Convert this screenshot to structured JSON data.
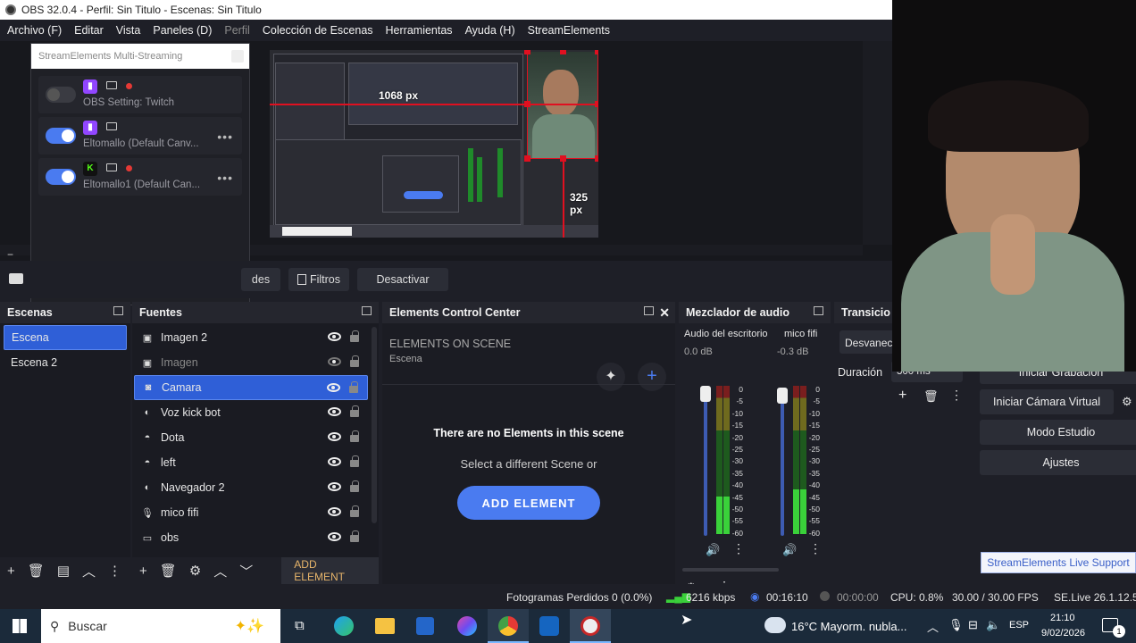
{
  "titlebar": {
    "title": "OBS 32.0.4 - Perfil: Sin Titulo - Escenas: Sin Titulo"
  },
  "menu": [
    "Archivo (F)",
    "Editar",
    "Vista",
    "Paneles (D)",
    "Perfil",
    "Colección de Escenas",
    "Herramientas",
    "Ayuda (H)",
    "StreamElements"
  ],
  "preview": {
    "width_label": "1068 px",
    "height_label": "325 px"
  },
  "multistream": {
    "title": "StreamElements Multi-Streaming",
    "rows": [
      {
        "label": "OBS Setting: Twitch",
        "platform": "twitch",
        "enabled": false
      },
      {
        "label": "Eltomallo (Default Canv...",
        "platform": "twitch",
        "enabled": true
      },
      {
        "label": "Eltomallo1 (Default Can...",
        "platform": "kick",
        "enabled": true
      }
    ]
  },
  "controls": {
    "props_partial": "des",
    "filters": "Filtros",
    "deactivate": "Desactivar"
  },
  "scenes": {
    "title": "Escenas",
    "items": [
      "Escena",
      "Escena 2"
    ]
  },
  "sources": {
    "title": "Fuentes",
    "items": [
      {
        "label": "Imagen 2",
        "icon": "image-icon",
        "visible": true
      },
      {
        "label": "Imagen",
        "icon": "image-icon",
        "visible": false
      },
      {
        "label": "Camara",
        "icon": "camera-icon",
        "visible": true
      },
      {
        "label": "Voz kick bot",
        "icon": "browser-icon",
        "visible": true
      },
      {
        "label": "Dota",
        "icon": "gamepad-icon",
        "visible": true
      },
      {
        "label": "left",
        "icon": "gamepad-icon",
        "visible": true
      },
      {
        "label": "Navegador 2",
        "icon": "browser-icon",
        "visible": true
      },
      {
        "label": "mico fifi",
        "icon": "microphone-icon",
        "visible": true
      },
      {
        "label": "obs",
        "icon": "monitor-icon",
        "visible": true
      }
    ],
    "add_element": "ADD ELEMENT"
  },
  "elements": {
    "title": "Elements Control Center",
    "heading": "ELEMENTS ON SCENE",
    "scene": "Escena",
    "empty": "There are no Elements in this scene",
    "hint": "Select a different Scene or",
    "button": "ADD ELEMENT"
  },
  "mixer": {
    "title": "Mezclador de audio",
    "channels": [
      {
        "name": "Audio del escritorio",
        "db": "0.0 dB",
        "level": 0.25
      },
      {
        "name": "mico fifi",
        "db": "-0.3 dB",
        "level": 0.3
      }
    ],
    "scale": [
      "0",
      "-5",
      "-10",
      "-15",
      "-20",
      "-25",
      "-30",
      "-35",
      "-40",
      "-45",
      "-50",
      "-55",
      "-60"
    ]
  },
  "transitions": {
    "title": "Transicio",
    "type": "Desvanec",
    "duration_label": "Duración",
    "duration": "300 ms"
  },
  "controls_right": [
    "Iniciar Grabación",
    "Iniciar Cámara Virtual",
    "Modo Estudio",
    "Ajustes"
  ],
  "se_support": "StreamElements Live Support",
  "status": {
    "dropped": "Fotogramas Perdidos 0 (0.0%)",
    "bitrate": "6216 kbps",
    "live_time": "00:16:10",
    "rec_time": "00:00:00",
    "cpu": "CPU: 0.8%",
    "fps": "30.00 / 30.00 FPS",
    "version": "SE.Live 26.1.12.53"
  },
  "taskbar": {
    "search": "Buscar",
    "weather": "16°C  Mayorm. nubla...",
    "lang": "ESP",
    "time": "21:10",
    "date": "9/02/2026",
    "notif_count": "1"
  },
  "colors": {
    "accent": "#2f5fd7",
    "se_blue": "#4a7bf0",
    "live_green": "#3ad13a"
  }
}
